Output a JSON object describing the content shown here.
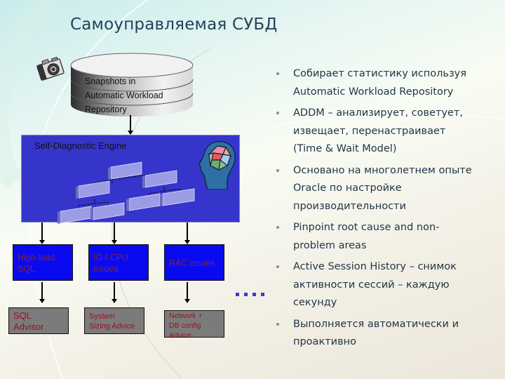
{
  "slide": {
    "title": "Самоуправляемая СУБД"
  },
  "diagram": {
    "repository": {
      "icon": "camera-icon",
      "lines": [
        "Snapshots in",
        "Automatic Workload",
        "Repository"
      ]
    },
    "engine": {
      "label": "Self-Diagnostic Engine",
      "icons": [
        "org-chart-icon",
        "head-brain-icon"
      ]
    },
    "issues": [
      {
        "label_lines": [
          "High-load",
          "SQL"
        ],
        "advice_lines": [
          "SQL",
          "Advisor"
        ]
      },
      {
        "label_lines": [
          "IO / CPU",
          "issues"
        ],
        "advice_lines": [
          "System",
          "Sizing Advice"
        ]
      },
      {
        "label_lines": [
          "RAC issues"
        ],
        "advice_lines": [
          "Network +",
          "DB config",
          "Advice"
        ]
      }
    ],
    "ellipsis": "more-issues-dots",
    "colors": {
      "engine_bg": "#3535cc",
      "issue_bg": "#0a0af0",
      "advice_bg": "#7b7b7b",
      "issue_text": "#7a2540",
      "advice_text": "#9c1020",
      "dots": "#3a3ad6"
    }
  },
  "bullets": [
    {
      "lines": [
        "Собирает статистику используя",
        "Automatic Workload Repository"
      ]
    },
    {
      "lines": [
        "ADDM –  анализирует, советует,",
        "извещает, перенастраивает",
        "(Time & Wait Model)"
      ]
    },
    {
      "lines": [
        "Основано на многолетнем опыте",
        "Oracle по настройке",
        "производительности"
      ]
    },
    {
      "lines": [
        "Pinpoint root cause and non-",
        "problem areas"
      ]
    },
    {
      "lines": [
        "Active Session History – снимок",
        "активности сессий – каждую",
        "секунду"
      ]
    },
    {
      "lines": [
        "Выполняется автоматически и",
        "проактивно"
      ]
    }
  ]
}
